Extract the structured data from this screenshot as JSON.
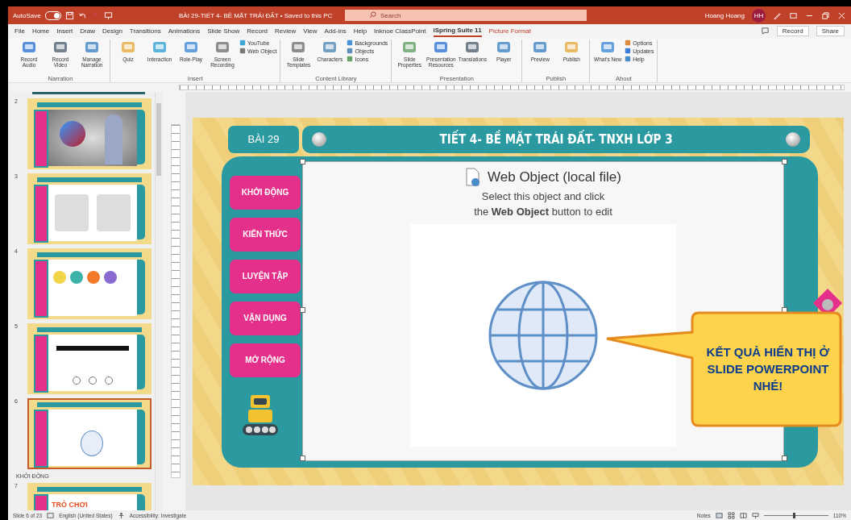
{
  "window": {
    "title": "BÀI 29-TIẾT 4- BỀ MẶT TRÁI ĐẤT • Saved to this PC",
    "autosave": {
      "label": "AutoSave",
      "on": true
    },
    "search": {
      "placeholder": "Search"
    },
    "user": {
      "name": "Hoang Hoang",
      "initials": "HH"
    }
  },
  "ribbon": {
    "tabs": [
      {
        "label": "File",
        "kind": "standard",
        "selected": false
      },
      {
        "label": "Home",
        "kind": "standard",
        "selected": false
      },
      {
        "label": "Insert",
        "kind": "standard",
        "selected": false
      },
      {
        "label": "Draw",
        "kind": "standard",
        "selected": false
      },
      {
        "label": "Design",
        "kind": "standard",
        "selected": false
      },
      {
        "label": "Transitions",
        "kind": "standard",
        "selected": false
      },
      {
        "label": "Animations",
        "kind": "standard",
        "selected": false
      },
      {
        "label": "Slide Show",
        "kind": "standard",
        "selected": false
      },
      {
        "label": "Record",
        "kind": "standard",
        "selected": false
      },
      {
        "label": "Review",
        "kind": "standard",
        "selected": false
      },
      {
        "label": "View",
        "kind": "standard",
        "selected": false
      },
      {
        "label": "Add-ins",
        "kind": "standard",
        "selected": false
      },
      {
        "label": "Help",
        "kind": "standard",
        "selected": false
      },
      {
        "label": "Inknoe ClassPoint",
        "kind": "standard",
        "selected": false
      },
      {
        "label": "iSpring Suite 11",
        "kind": "standard",
        "selected": true
      },
      {
        "label": "Picture Format",
        "kind": "contextual",
        "selected": false
      }
    ],
    "actions": [
      {
        "label": "Record"
      },
      {
        "label": "Share"
      }
    ],
    "groups": [
      {
        "label": "Narration",
        "items": [
          {
            "kind": "large",
            "label": "Record Audio"
          },
          {
            "kind": "large",
            "label": "Record Video"
          },
          {
            "kind": "large",
            "label": "Manage Narration"
          }
        ]
      },
      {
        "label": "Insert",
        "items": [
          {
            "kind": "large",
            "label": "Quiz"
          },
          {
            "kind": "large",
            "label": "Interaction"
          },
          {
            "kind": "large",
            "label": "Role-Play"
          },
          {
            "kind": "large",
            "label": "Screen Recording"
          },
          {
            "kind": "stack",
            "items": [
              {
                "label": "YouTube"
              },
              {
                "label": "Web Object"
              }
            ]
          }
        ]
      },
      {
        "label": "Content Library",
        "items": [
          {
            "kind": "large",
            "label": "Slide Templates"
          },
          {
            "kind": "large",
            "label": "Characters"
          },
          {
            "kind": "stack",
            "items": [
              {
                "label": "Backgrounds"
              },
              {
                "label": "Objects"
              },
              {
                "label": "Icons"
              }
            ]
          }
        ]
      },
      {
        "label": "Presentation",
        "items": [
          {
            "kind": "large",
            "label": "Slide Properties"
          },
          {
            "kind": "large",
            "label": "Presentation Resources"
          },
          {
            "kind": "large",
            "label": "Translations"
          },
          {
            "kind": "large",
            "label": "Player"
          }
        ]
      },
      {
        "label": "Publish",
        "items": [
          {
            "kind": "large",
            "label": "Preview"
          },
          {
            "kind": "large",
            "label": "Publish"
          }
        ]
      },
      {
        "label": "About",
        "items": [
          {
            "kind": "large",
            "label": "What's New"
          },
          {
            "kind": "stack",
            "items": [
              {
                "label": "Options"
              },
              {
                "label": "Updates"
              },
              {
                "label": "Help"
              }
            ]
          }
        ]
      }
    ]
  },
  "thumbnails": [
    {
      "kind": "video",
      "number": "2",
      "selected": false
    },
    {
      "kind": "text",
      "number": "3",
      "selected": false
    },
    {
      "kind": "cards",
      "number": "4",
      "selected": false
    },
    {
      "kind": "web",
      "number": "5",
      "selected": false
    },
    {
      "kind": "globe",
      "number": "6",
      "selected": true
    },
    {
      "kind": "section",
      "label": "KHỞI ĐỘNG"
    },
    {
      "kind": "game",
      "number": "7",
      "caption": "TRÒ CHƠI",
      "selected": false
    }
  ],
  "slide": {
    "lesson": "BÀI 29",
    "title": "TIẾT 4- BỀ MẶT TRÁI ĐẤT- TNXH LỚP 3",
    "menu": [
      "KHỞI ĐỘNG",
      "KIẾN THỨC",
      "LUYỆN TẬP",
      "VẬN DỤNG",
      "MỞ RỘNG"
    ],
    "web_object": {
      "title": "Web Object (local file)",
      "line_1": "Select this object and click",
      "line_2": "the **Web Object**  button to edit"
    },
    "callout": "KẾT QUẢ HIỂN THỊ Ở SLIDE POWERPOINT NHÉ!"
  },
  "status_bar": {
    "slide": "Slide 6 of 23",
    "language": "English (United States)",
    "accessibility": "Accessibility: Investigate",
    "notes": "Notes",
    "zoom": {
      "level": 0.45,
      "reading": "110%"
    }
  }
}
